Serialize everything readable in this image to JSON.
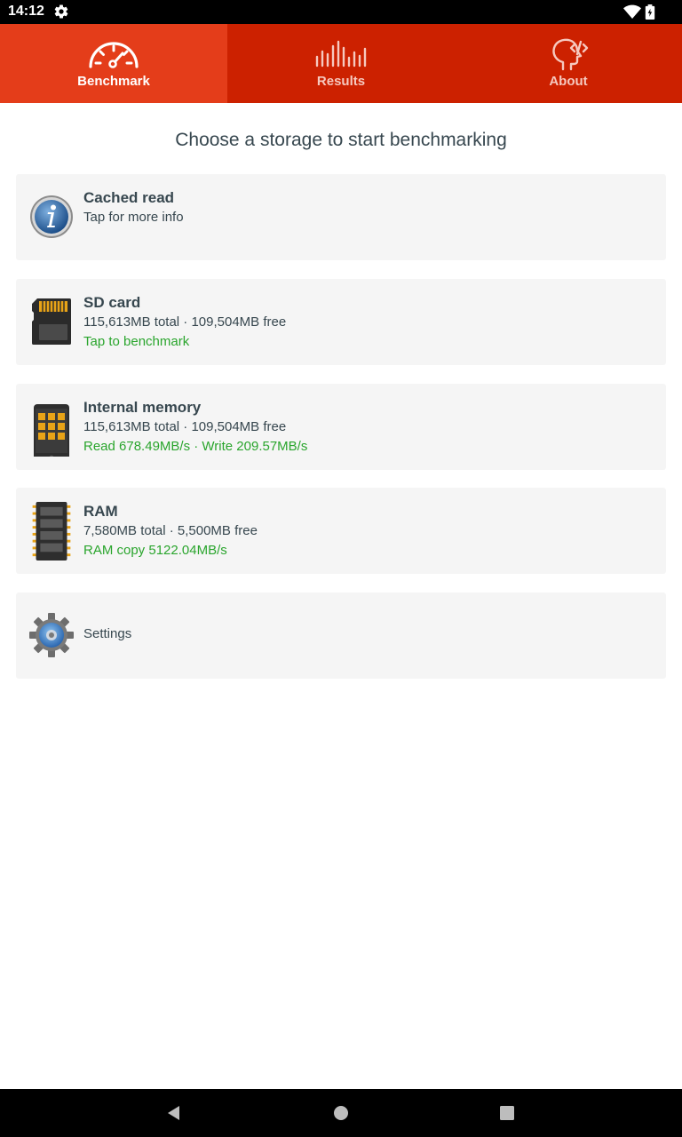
{
  "status_bar": {
    "time": "14:12"
  },
  "tabs": [
    {
      "label": "Benchmark",
      "icon": "speedometer-icon",
      "active": true
    },
    {
      "label": "Results",
      "icon": "bar-chart-icon",
      "active": false
    },
    {
      "label": "About",
      "icon": "head-code-icon",
      "active": false
    }
  ],
  "heading": "Choose a storage to start benchmarking",
  "cards": [
    {
      "title": "Cached read",
      "subtitle": "Tap for more info",
      "status": "",
      "icon": "info-icon"
    },
    {
      "title": "SD card",
      "subtitle": "115,613MB total · 109,504MB free",
      "status": "Tap to benchmark",
      "icon": "sd-card-icon"
    },
    {
      "title": "Internal memory",
      "subtitle": "115,613MB total · 109,504MB free",
      "status": "Read 678.49MB/s · Write 209.57MB/s",
      "icon": "phone-memory-icon"
    },
    {
      "title": "RAM",
      "subtitle": "7,580MB total · 5,500MB free",
      "status": "RAM copy 5122.04MB/s",
      "icon": "ram-chip-icon"
    }
  ],
  "settings": {
    "label": "Settings",
    "icon": "settings-gear-icon"
  },
  "colors": {
    "tab_bar": "#cc2100",
    "tab_active": "#e43d1a",
    "status_green": "#2aa52d",
    "text_dark": "#37474f",
    "card_bg": "#f5f5f5"
  }
}
